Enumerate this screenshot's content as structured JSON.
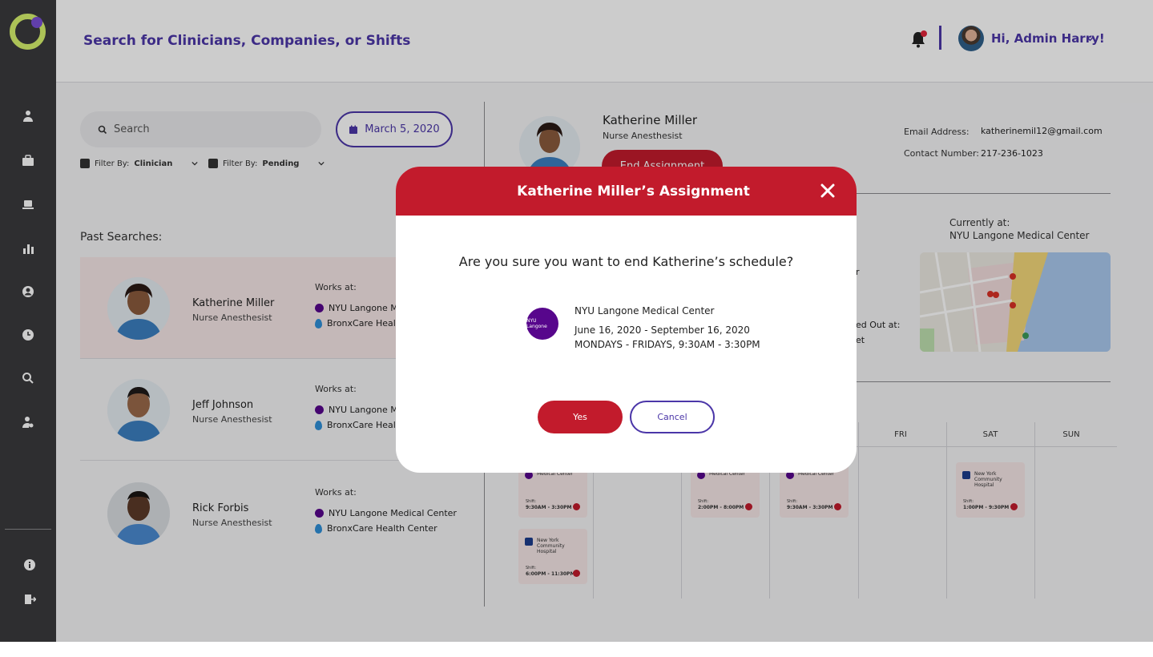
{
  "header": {
    "search_prompt": "Search for Clinicians, Companies, or Shifts",
    "greeting": "Hi, Admin Harry!"
  },
  "sidebar": {
    "icons": [
      "clinician-icon",
      "briefcase-icon",
      "laptop-icon",
      "chart-icon",
      "user-circle-icon",
      "clock-icon",
      "search-icon",
      "user-settings-icon"
    ],
    "bottom_icons": [
      "info-icon",
      "logout-icon"
    ]
  },
  "search": {
    "placeholder": "Search",
    "date": "March 5, 2020",
    "filter_clinician_prefix": "Filter By:",
    "filter_clinician_value": "Clinician",
    "filter_status_prefix": "Filter By:",
    "filter_status_value": "Pending"
  },
  "past_searches": {
    "label": "Past Searches:",
    "works_at_label": "Works at:",
    "people": [
      {
        "name": "Katherine Miller",
        "role": "Nurse Anesthesist",
        "workplaces": [
          "NYU Langone Me",
          "BronxCare Healt"
        ]
      },
      {
        "name": "Jeff Johnson",
        "role": "Nurse Anesthesist",
        "workplaces": [
          "NYU Langone Me",
          "BronxCare Healt"
        ]
      },
      {
        "name": "Rick Forbis",
        "role": "Nurse Anesthesist",
        "workplaces": [
          "NYU Langone Medical Center",
          "BronxCare Health Center"
        ]
      }
    ]
  },
  "detail": {
    "name": "Katherine Miller",
    "role": "Nurse Anesthesist",
    "end_button": "End Assignment",
    "email_label": "Email Address:",
    "email": "katherinemil12@gmail.com",
    "phone_label": "Contact Number:",
    "phone": "217-236-1023",
    "currently_label": "Currently at:",
    "currently_value": "NYU Langone Medical Center",
    "partial_r": "r",
    "partial_out": "ed Out at:",
    "partial_et": "et"
  },
  "calendar": {
    "days": [
      "FRI",
      "SAT",
      "SUN"
    ],
    "shifts": [
      {
        "place": "Medical Center",
        "shift_label": "Shift:",
        "time": "9:30AM - 3:30PM"
      },
      {
        "place": "Medical Center",
        "shift_label": "Shift:",
        "time": "2:00PM - 8:00PM"
      },
      {
        "place": "Medical Center",
        "shift_label": "Shift:",
        "time": "9:30AM - 3:30PM"
      },
      {
        "place": "New York Community Hospital",
        "shift_label": "Shift:",
        "time": "1:00PM - 9:30PM"
      },
      {
        "place": "New York Community Hospital",
        "shift_label": "Shift:",
        "time": "6:00PM - 11:30PM"
      }
    ]
  },
  "modal": {
    "title": "Katherine Miller’s Assignment",
    "question": "Are you sure you want to end Katherine’s schedule?",
    "logo_text": "NYU Langone",
    "facility": "NYU Langone Medical Center",
    "dates": "June 16, 2020 - September 16, 2020",
    "days": "MONDAYS - FRIDAYS, 9:30AM - 3:30PM",
    "yes_label": "Yes",
    "cancel_label": "Cancel"
  },
  "colors": {
    "brand_purple": "#4b36a8",
    "accent_red": "#c21b2c",
    "sidebar": "#3a3a3c",
    "logo_lime": "#d8f36d"
  }
}
